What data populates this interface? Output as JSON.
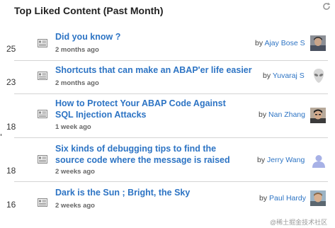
{
  "widget": {
    "title": "Top Liked Content (Past Month)"
  },
  "icons": {
    "refresh": "refresh-icon",
    "document": "document-icon"
  },
  "colors": {
    "link": "#2d74c4",
    "divider": "#d4d4d4"
  },
  "items": [
    {
      "count": "25",
      "title": "Did you know ?",
      "age": "2 months ago",
      "by": "by",
      "author": "Ajay Bose S",
      "avatar": "profile-photo"
    },
    {
      "count": "23",
      "title": "Shortcuts that can make an ABAP'er life easier",
      "age": "2 months ago",
      "by": "by",
      "author": "Yuvaraj S",
      "avatar": "alien-avatar"
    },
    {
      "count": "18",
      "title": "How to Protect Your ABAP Code Against SQL Injection Attacks",
      "age": "1 week ago",
      "by": "by",
      "author": "Nan Zhang",
      "avatar": "profile-photo"
    },
    {
      "count": "18",
      "title": "Six kinds of debugging tips to find the source code where the message is raised",
      "age": "2 weeks ago",
      "by": "by",
      "author": "Jerry Wang",
      "avatar": "default-person-avatar"
    },
    {
      "count": "16",
      "title": "Dark is the Sun ; Bright, the Sky",
      "age": "2 weeks ago",
      "by": "by",
      "author": "Paul Hardy",
      "avatar": "profile-photo"
    }
  ],
  "watermark": "@稀土掘金技术社区"
}
